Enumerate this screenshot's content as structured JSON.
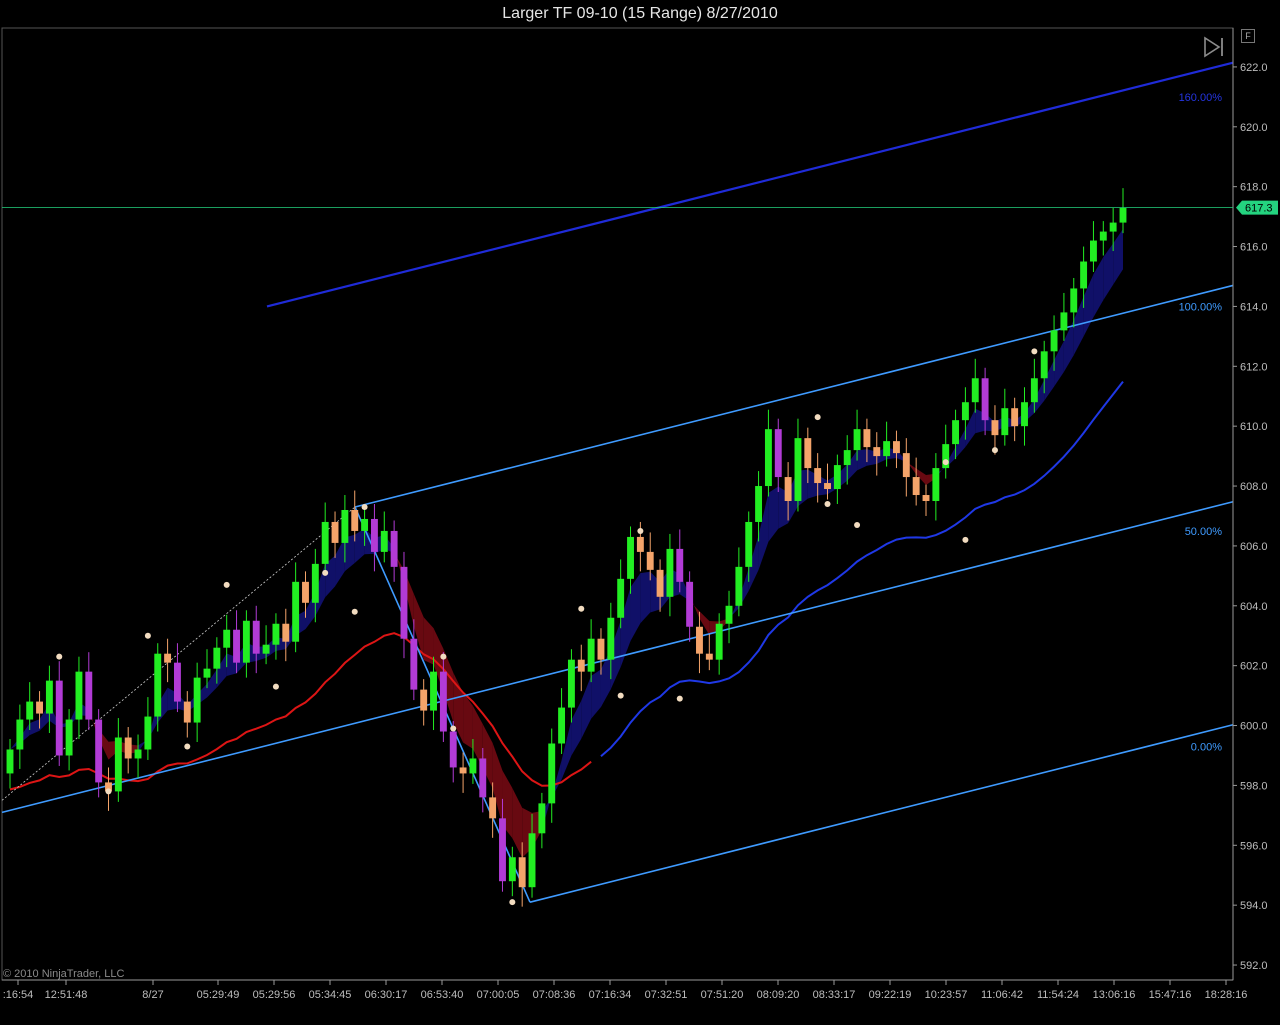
{
  "window": {
    "title": "Larger TF 09-10 (15 Range)  8/27/2010",
    "f_button": "F",
    "copyright": "© 2010 NinjaTrader, LLC",
    "play_icon": "skip-forward-icon"
  },
  "colors": {
    "background": "#000000",
    "axis": "#9a9a9a",
    "bull_candle": "#22ee22",
    "bear_candle": "#f4a46a",
    "bear_strong_candle": "#b23bd6",
    "channel_line": "#3f9bff",
    "upper_line": "#1f2bd8",
    "ma_red": "#dd1515",
    "ma_blue": "#1f38e6",
    "band_bull": "#11116e",
    "band_bear": "#6e0a12",
    "last_price": "#24d37f",
    "pivot_dot": "#f2dcc0"
  },
  "chart_data": {
    "type": "candlestick",
    "ylim": [
      591.5,
      623.3
    ],
    "y_ticks": [
      "622.0",
      "620.0",
      "618.0",
      "616.0",
      "614.0",
      "612.0",
      "610.0",
      "608.0",
      "606.0",
      "604.0",
      "602.0",
      "600.0",
      "598.0",
      "596.0",
      "594.0",
      "592.0"
    ],
    "x_ticks": [
      ":16:54",
      "12:51:48",
      "8/27",
      "05:29:49",
      "05:29:56",
      "05:34:45",
      "06:30:17",
      "06:53:40",
      "07:00:05",
      "07:08:36",
      "07:16:34",
      "07:32:51",
      "07:51:20",
      "08:09:20",
      "08:33:17",
      "09:22:19",
      "10:23:57",
      "11:06:42",
      "11:54:24",
      "13:06:16",
      "15:47:16",
      "18:28:16"
    ],
    "last_price": "617.3",
    "last_price_value": 617.3,
    "fib_levels": [
      {
        "label": "160.00%",
        "color": "#2535e0"
      },
      {
        "label": "100.00%",
        "color": "#3f9bff"
      },
      {
        "label": "50.00%",
        "color": "#3f9bff"
      },
      {
        "label": "0.00%",
        "color": "#3f9bff"
      }
    ],
    "series": {
      "close": [
        599.2,
        600.2,
        600.8,
        600.4,
        601.5,
        599.0,
        600.2,
        601.8,
        600.2,
        598.1,
        597.8,
        599.6,
        598.9,
        599.2,
        600.3,
        602.4,
        602.1,
        600.8,
        600.1,
        601.6,
        601.9,
        602.6,
        603.2,
        602.1,
        603.5,
        602.4,
        602.7,
        603.4,
        602.8,
        604.8,
        604.1,
        605.4,
        606.8,
        606.1,
        607.2,
        606.5,
        606.9,
        605.8,
        606.5,
        605.3,
        602.9,
        601.2,
        600.5,
        601.8,
        599.8,
        598.6,
        598.4,
        598.9,
        597.6,
        596.9,
        594.8,
        595.6,
        594.6,
        596.4,
        597.4,
        599.4,
        600.6,
        602.2,
        601.8,
        602.9,
        602.2,
        603.6,
        604.9,
        606.3,
        605.8,
        605.2,
        604.3,
        605.9,
        604.8,
        603.3,
        602.4,
        602.2,
        603.4,
        604.0,
        605.3,
        606.8,
        608.0,
        609.9,
        608.3,
        607.5,
        609.6,
        608.6,
        608.1,
        607.9,
        608.7,
        609.2,
        609.9,
        609.3,
        609.0,
        609.5,
        609.1,
        608.3,
        607.7,
        607.5,
        608.6,
        609.4,
        610.2,
        610.8,
        611.6,
        610.2,
        609.7,
        610.6,
        610.0,
        610.8,
        611.6,
        612.5,
        613.2,
        613.8,
        614.6,
        615.5,
        616.2,
        616.5,
        616.8,
        617.3
      ],
      "candles_shown": 114
    },
    "pivots": [
      602.3,
      597.8,
      603.0,
      599.3,
      604.7,
      601.3,
      605.1,
      603.8,
      607.3,
      602.3,
      599.9,
      594.1,
      603.9,
      601.0,
      606.5,
      600.9,
      610.3,
      607.4,
      606.7,
      608.8,
      606.2,
      609.2,
      612.5
    ],
    "annotations": []
  }
}
